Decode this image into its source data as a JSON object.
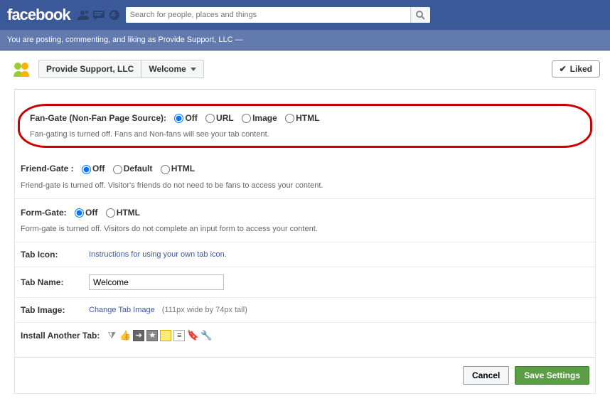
{
  "brand": "facebook",
  "search": {
    "placeholder": "Search for people, places and things"
  },
  "subbar": {
    "text": "You are posting, commenting, and liking as Provide Support, LLC —"
  },
  "header": {
    "page_name": "Provide Support, LLC",
    "tab_name": "Welcome",
    "liked_label": "Liked"
  },
  "fan_gate": {
    "title": "Fan-Gate (Non-Fan Page Source):",
    "options": {
      "off": "Off",
      "url": "URL",
      "image": "Image",
      "html": "HTML"
    },
    "selected": "off",
    "help": "Fan-gating is turned off. Fans and Non-fans will see your tab content."
  },
  "friend_gate": {
    "title": "Friend-Gate :",
    "options": {
      "off": "Off",
      "default": "Default",
      "html": "HTML"
    },
    "selected": "off",
    "help": "Friend-gate is turned off. Visitor's friends do not need to be fans to access your content."
  },
  "form_gate": {
    "title": "Form-Gate:",
    "options": {
      "off": "Off",
      "html": "HTML"
    },
    "selected": "off",
    "help": "Form-gate is turned off. Visitors do not complete an input form to access your content."
  },
  "tab_icon": {
    "label": "Tab Icon:",
    "link": "Instructions for using your own tab icon."
  },
  "tab_name": {
    "label": "Tab Name:",
    "value": "Welcome"
  },
  "tab_image": {
    "label": "Tab Image:",
    "link": "Change Tab Image",
    "hint": "(111px wide by 74px tall)"
  },
  "install": {
    "label": "Install Another Tab:"
  },
  "footer": {
    "cancel": "Cancel",
    "save": "Save Settings"
  }
}
